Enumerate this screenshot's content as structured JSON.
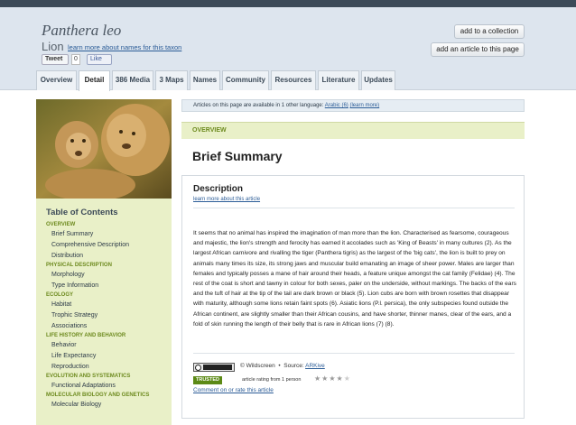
{
  "taxon": {
    "scientific_name": "Panthera leo",
    "common_name": "Lion",
    "names_link": "learn more about names for this taxon"
  },
  "social": {
    "tweet_label": "Tweet",
    "tweet_count": "0",
    "like_label": "Like"
  },
  "actions": {
    "add_collection": "add to a collection",
    "add_article": "add an article to this page"
  },
  "tabs": [
    {
      "label": "Overview"
    },
    {
      "label": "Detail"
    },
    {
      "label": "386 Media"
    },
    {
      "label": "3 Maps"
    },
    {
      "label": "Names"
    },
    {
      "label": "Community"
    },
    {
      "label": "Resources"
    },
    {
      "label": "Literature"
    },
    {
      "label": "Updates"
    }
  ],
  "toc": {
    "title": "Table of Contents",
    "sections": [
      {
        "heading": "Overview",
        "items": [
          "Brief Summary",
          "Comprehensive Description",
          "Distribution"
        ]
      },
      {
        "heading": "Physical Description",
        "items": [
          "Morphology",
          "Type Information"
        ]
      },
      {
        "heading": "Ecology",
        "items": [
          "Habitat",
          "Trophic Strategy",
          "Associations"
        ]
      },
      {
        "heading": "Life History and Behavior",
        "items": [
          "Behavior",
          "Life Expectancy",
          "Reproduction"
        ]
      },
      {
        "heading": "Evolution and Systematics",
        "items": [
          "Functional Adaptations"
        ]
      },
      {
        "heading": "Molecular Biology and Genetics",
        "items": [
          "Molecular Biology"
        ]
      }
    ]
  },
  "language_bar": {
    "text": "Articles on this page are available in 1 other language:",
    "language_link": "Arabic (6)",
    "learn_more": "(learn more)"
  },
  "section_label": "Overview",
  "page_heading": "Brief Summary",
  "description": {
    "title": "Description",
    "link": "learn more about this article",
    "body": "It seems that no animal has inspired the imagination of man more than the lion. Characterised as fearsome, courageous and majestic, the lion's strength and ferocity has earned it accolades such as 'King of Beasts' in many cultures (2). As the largest African carnivore and rivalling the tiger (Panthera tigris) as the largest of the 'big cats', the lion is built to prey on animals many times its size, its strong jaws and muscular build emanating an image of sheer power. Males are larger than females and typically posses a mane of hair around their heads, a feature unique amongst the cat family (Felidae) (4). The rest of the coat is short and tawny in colour for both sexes, paler on the underside, without markings. The backs of the ears and the tuft of hair at the tip of the tail are dark brown or black (5). Lion cubs are born with brown rosettes that disappear with maturity, although some lions retain faint spots (6). Asiatic lions (P.l. persica), the only subspecies found outside the African continent, are slightly smaller than their African cousins, and have shorter, thinner manes, clear of the ears, and a fold of skin running the length of their belly that is rare in African lions (7) (8)."
  },
  "license": {
    "badge": "CC BY-NC-SA",
    "rights": "© Wildscreen",
    "source_label": "Source:",
    "source_link": "ARKive"
  },
  "trust": {
    "badge": "TRUSTED",
    "rating_text": "article rating from 1 person",
    "stars": 4,
    "stars_max": 5
  },
  "comment_link": "Comment on or rate this article"
}
